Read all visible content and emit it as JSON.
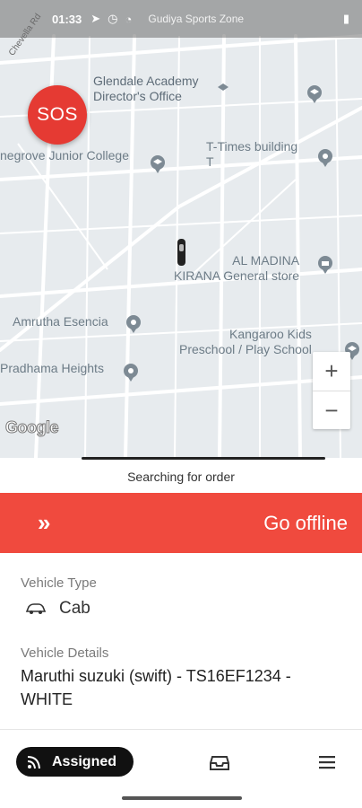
{
  "status_bar": {
    "time": "01:33",
    "carrier_label": "Gudiya Sports Zone"
  },
  "map": {
    "road_label": "Chevella Rd",
    "pois": [
      {
        "id": "glendale",
        "text": "Glendale Academy\nDirector's Office",
        "icon": "school-pin-icon"
      },
      {
        "id": "junior",
        "text": "negrove Junior College",
        "icon": "school-pin-icon"
      },
      {
        "id": "ttimes",
        "text": "T-Times building\nT",
        "icon": "location-pin-icon"
      },
      {
        "id": "almadina",
        "text": "AL MADINA\nKIRANA General store",
        "icon": "shop-pin-icon"
      },
      {
        "id": "amrutha",
        "text": "Amrutha Esencia",
        "icon": "location-pin-icon"
      },
      {
        "id": "kangaroo",
        "text": "Kangaroo Kids\nPreschool / Play School",
        "icon": "school-pin-icon"
      },
      {
        "id": "pradhama",
        "text": "Pradhama Heights",
        "icon": "location-pin-icon"
      }
    ],
    "sos_label": "SOS",
    "zoom_in": "+",
    "zoom_out": "−",
    "attribution": "Google"
  },
  "status": {
    "searching_text": "Searching for order"
  },
  "offline_bar": {
    "chevron": "»",
    "label": "Go offline",
    "color": "#f04a3e"
  },
  "vehicle": {
    "type_label": "Vehicle Type",
    "type_value": "Cab",
    "type_icon": "car-icon",
    "details_label": "Vehicle Details",
    "details_value": "Maruthi suzuki (swift) - TS16EF1234 - WHITE"
  },
  "bottom_nav": {
    "assigned_label": "Assigned",
    "assigned_icon": "signal-icon",
    "inbox_icon": "inbox-icon",
    "menu_icon": "menu-icon"
  }
}
